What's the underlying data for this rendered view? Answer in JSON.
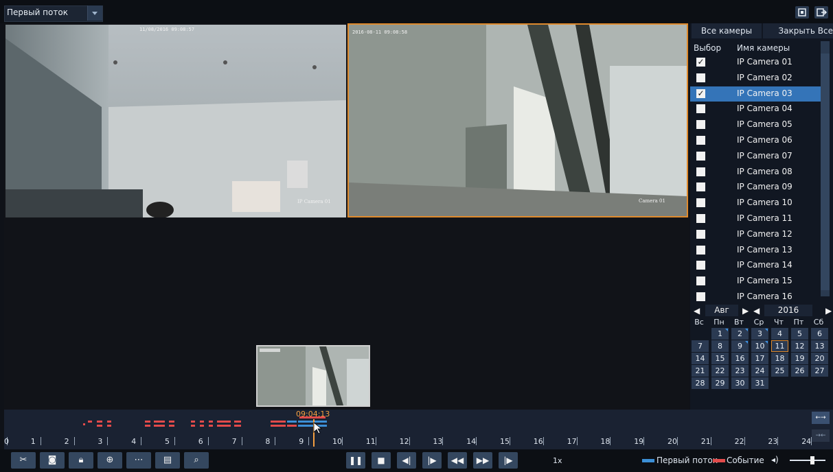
{
  "topbar": {
    "stream_label": "Первый поток",
    "fullscreen_icon": "fullscreen-icon",
    "exit_icon": "exit-icon"
  },
  "video": {
    "tile1": {
      "timestamp": "11/08/2016 09:08:57",
      "camera_label": "IP Camera 01"
    },
    "tile2": {
      "timestamp": "2016-08-11 09:08:58",
      "camera_label": "Camera 01"
    },
    "pip": {
      "label": ""
    }
  },
  "panel": {
    "all_cameras_label": "Все камеры",
    "close_all_label": "Закрыть Все",
    "col_select": "Выбор",
    "col_name": "Имя камеры",
    "cameras": [
      {
        "name": "IP Camera 01",
        "checked": true,
        "selected": false
      },
      {
        "name": "IP Camera 02",
        "checked": false,
        "selected": false
      },
      {
        "name": "IP Camera 03",
        "checked": true,
        "selected": true
      },
      {
        "name": "IP Camera 04",
        "checked": false,
        "selected": false
      },
      {
        "name": "IP Camera 05",
        "checked": false,
        "selected": false
      },
      {
        "name": "IP Camera 06",
        "checked": false,
        "selected": false
      },
      {
        "name": "IP Camera 07",
        "checked": false,
        "selected": false
      },
      {
        "name": "IP Camera 08",
        "checked": false,
        "selected": false
      },
      {
        "name": "IP Camera 09",
        "checked": false,
        "selected": false
      },
      {
        "name": "IP Camera 10",
        "checked": false,
        "selected": false
      },
      {
        "name": "IP Camera 11",
        "checked": false,
        "selected": false
      },
      {
        "name": "IP Camera 12",
        "checked": false,
        "selected": false
      },
      {
        "name": "IP Camera 13",
        "checked": false,
        "selected": false
      },
      {
        "name": "IP Camera 14",
        "checked": false,
        "selected": false
      },
      {
        "name": "IP Camera 15",
        "checked": false,
        "selected": false
      },
      {
        "name": "IP Camera 16",
        "checked": false,
        "selected": false
      }
    ],
    "calendar": {
      "month": "Авг",
      "year": "2016",
      "weekdays": [
        "Вс",
        "Пн",
        "Вт",
        "Ср",
        "Чт",
        "Пт",
        "Сб"
      ],
      "today": "11",
      "weeks": [
        [
          "",
          "1",
          "2",
          "3",
          "4",
          "5",
          "6"
        ],
        [
          "7",
          "8",
          "9",
          "10",
          "11",
          "12",
          "13"
        ],
        [
          "14",
          "15",
          "16",
          "17",
          "18",
          "19",
          "20"
        ],
        [
          "21",
          "22",
          "23",
          "24",
          "25",
          "26",
          "27"
        ],
        [
          "28",
          "29",
          "30",
          "31",
          "",
          "",
          ""
        ]
      ],
      "recorded_days": [
        "1",
        "2",
        "3",
        "9",
        "10"
      ]
    }
  },
  "timeline": {
    "cursor_time": "09:04:13",
    "hours": [
      "0",
      "1",
      "2",
      "3",
      "4",
      "5",
      "6",
      "7",
      "8",
      "9",
      "10",
      "11",
      "12",
      "13",
      "14",
      "15",
      "16",
      "17",
      "18",
      "19",
      "20",
      "21",
      "22",
      "23",
      "24"
    ],
    "event_color": "#e24b4b",
    "normal_color": "#3c8fd6"
  },
  "toolbar": {
    "speed": "1x",
    "legend_normal": "Первый поток",
    "legend_event": "Событие"
  },
  "colors": {
    "accent": "#e08a2c",
    "selection": "#3474b8",
    "button": "#34475f"
  }
}
